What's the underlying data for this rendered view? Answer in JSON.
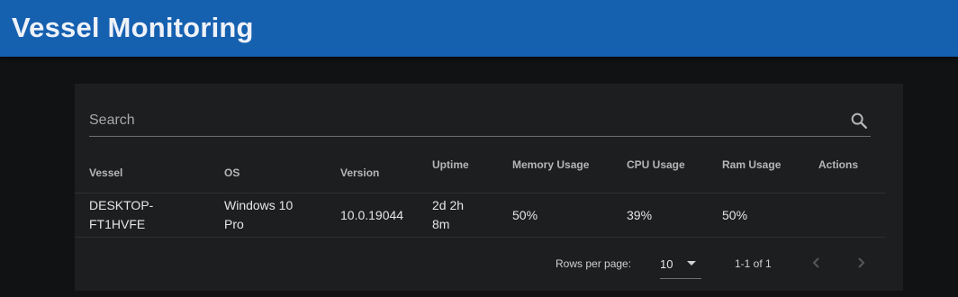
{
  "header": {
    "title": "Vessel Monitoring",
    "bg_color": "#1660b0"
  },
  "search": {
    "placeholder": "Search",
    "icon": "search-icon"
  },
  "table": {
    "columns": [
      "Vessel",
      "OS",
      "Version",
      "Uptime",
      "Memory Usage",
      "CPU Usage",
      "Ram Usage",
      "Actions"
    ],
    "rows": [
      {
        "vessel_line1": "DESKTOP-",
        "vessel_line2": "FT1HVFE",
        "os_line1": "Windows 10",
        "os_line2": "Pro",
        "version": "10.0.19044",
        "uptime_line1": "2d 2h",
        "uptime_line2": "8m",
        "memory": "50%",
        "cpu": "39%",
        "ram": "50%"
      }
    ]
  },
  "pagination": {
    "rows_per_page_label": "Rows per page:",
    "rows_per_page_value": "10",
    "range": "1-1 of 1",
    "prev_icon": "chevron-left-icon",
    "next_icon": "chevron-right-icon"
  }
}
